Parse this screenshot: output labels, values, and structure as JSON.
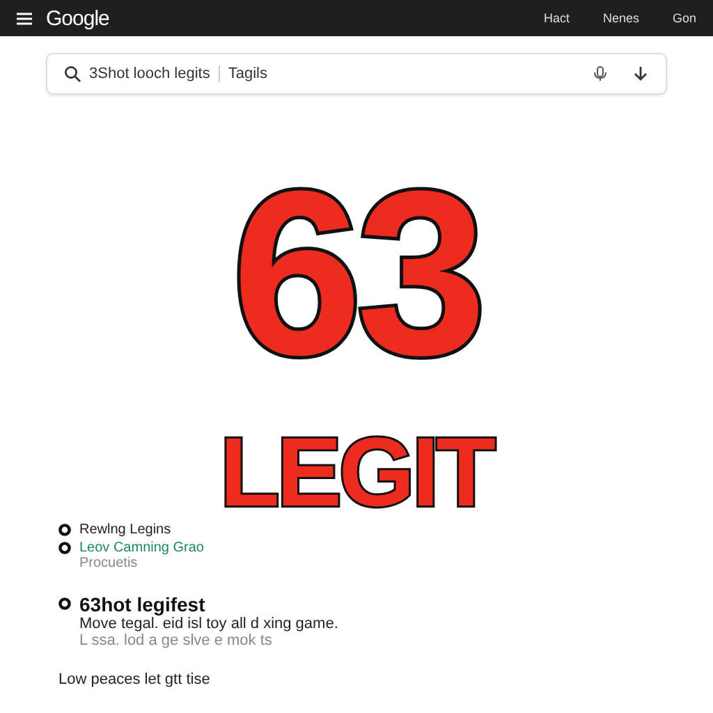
{
  "header": {
    "logo": "Google",
    "links": [
      "Hact",
      "Nenes",
      "Gon"
    ]
  },
  "search": {
    "value": "3Shot looch legits",
    "value_2": "Tagils"
  },
  "hero": {
    "number": "63",
    "word": "LEGIT"
  },
  "results": [
    {
      "kind": "link",
      "title": "Rewlng Legins"
    },
    {
      "kind": "green",
      "title": "Leov Camning Grao",
      "subtitle": "Procuetis"
    },
    {
      "kind": "main",
      "title": "63hot legifest",
      "lines": [
        "Move tegal. eid isl toy all d xing game.",
        "L ssa. lod a ge slve e mok ts"
      ]
    },
    {
      "kind": "plain",
      "title": "Low peaces let gtt tise"
    }
  ]
}
